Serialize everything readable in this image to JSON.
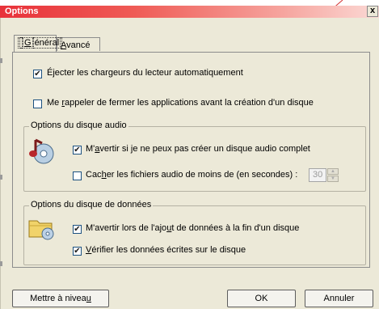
{
  "window": {
    "title": "Options",
    "close_label": "x"
  },
  "tabs": [
    {
      "label_pre": "",
      "label_u": "G",
      "label_post": "énéral",
      "active": true
    },
    {
      "label_pre": "",
      "label_u": "A",
      "label_post": "vancé",
      "active": false
    }
  ],
  "options": {
    "eject": {
      "pre": "É",
      "u": "j",
      "post": "ecter les chargeurs du lecteur automatiquement",
      "checked": true
    },
    "remind": {
      "pre": "Me ",
      "u": "r",
      "post": "appeler de fermer les applications avant la création d'un disque",
      "checked": false
    }
  },
  "audio_group": {
    "title": "Options du disque audio",
    "icon": "music-cd-icon",
    "warn": {
      "pre": "M'",
      "u": "a",
      "post": "vertir si je ne peux pas créer un disque audio complet",
      "checked": true
    },
    "hide": {
      "pre": "Cac",
      "u": "h",
      "post": "er les fichiers audio de moins de (en secondes) :",
      "checked": false
    },
    "seconds_value": "30"
  },
  "data_group": {
    "title": "Options du disque de données",
    "icon": "folder-cd-icon",
    "warn_append": {
      "pre": "M'avertir lors de l'ajo",
      "u": "u",
      "post": "t de données à la fin d'un disque",
      "checked": true
    },
    "verify": {
      "pre": "",
      "u": "V",
      "post": "érifier les données écrites sur le disque",
      "checked": true
    }
  },
  "buttons": {
    "upgrade": {
      "pre": "Mettre à nivea",
      "u": "u",
      "post": ""
    },
    "ok": "OK",
    "cancel": "Annuler"
  },
  "check_glyph": "✔"
}
